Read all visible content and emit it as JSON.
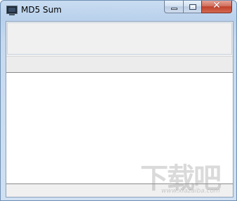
{
  "window": {
    "title": "MD5 Sum",
    "icon": "monitor-icon"
  },
  "caption_buttons": {
    "minimize_icon": "minimize-icon",
    "maximize_icon": "maximize-icon",
    "close_glyph": "✕"
  },
  "input_panel": {
    "value": ""
  },
  "output": {
    "text": ""
  },
  "status_bar": {
    "text": ""
  },
  "watermark": {
    "text": "下载吧",
    "url": "www.xiazaiba.com"
  },
  "colors": {
    "titlebar": "#b9d1ec",
    "client_background": "#f0f0f0",
    "close_button": "#c0402a"
  }
}
